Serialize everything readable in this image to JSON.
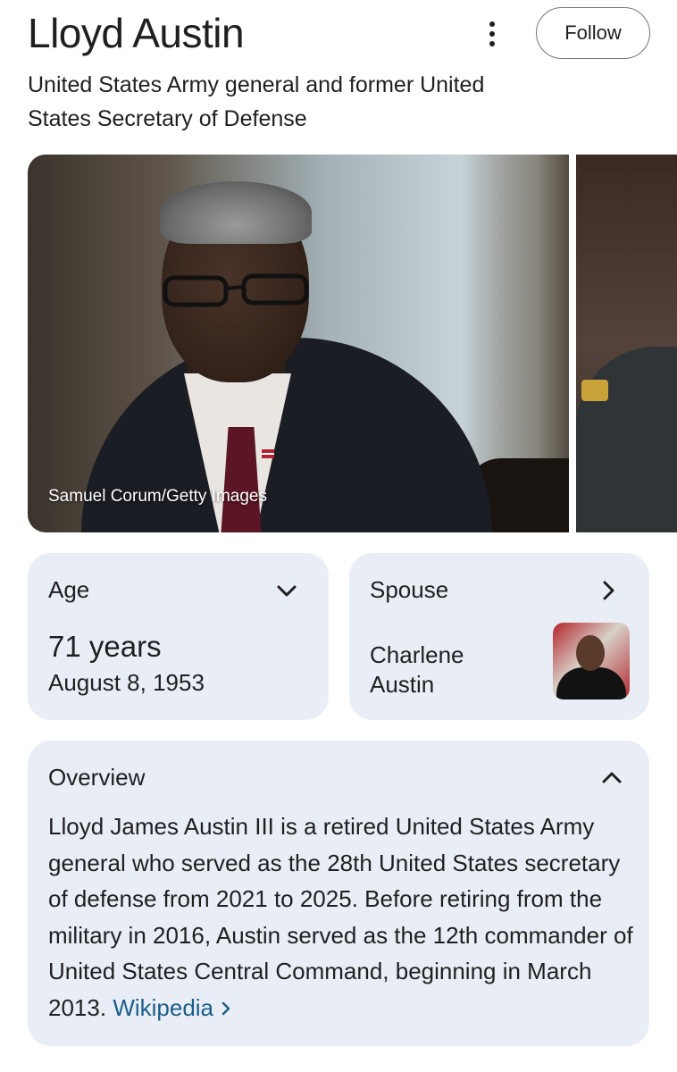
{
  "header": {
    "title": "Lloyd Austin",
    "subtitle": "United States Army general and former United States Secretary of Defense",
    "follow_label": "Follow",
    "more_icon": "more-vert-icon"
  },
  "gallery": {
    "credit": "Samuel Corum/Getty Images"
  },
  "cards": {
    "age": {
      "label": "Age",
      "value": "71 years",
      "date": "August 8, 1953",
      "icon": "chevron-down-icon"
    },
    "spouse": {
      "label": "Spouse",
      "name": "Charlene Austin",
      "icon": "chevron-right-icon"
    },
    "overview": {
      "label": "Overview",
      "text": "Lloyd James Austin III is a retired United States Army general who served as the 28th United States secretary of defense from 2021 to 2025. Before retiring from the military in 2016, Austin served as the 12th commander of United States Central Command, beginning in March 2013.",
      "source_label": "Wikipedia",
      "icon": "chevron-up-icon"
    }
  },
  "colors": {
    "card_bg": "#e9eef6",
    "link": "#1a5d8a",
    "text": "#1f1f1f"
  }
}
